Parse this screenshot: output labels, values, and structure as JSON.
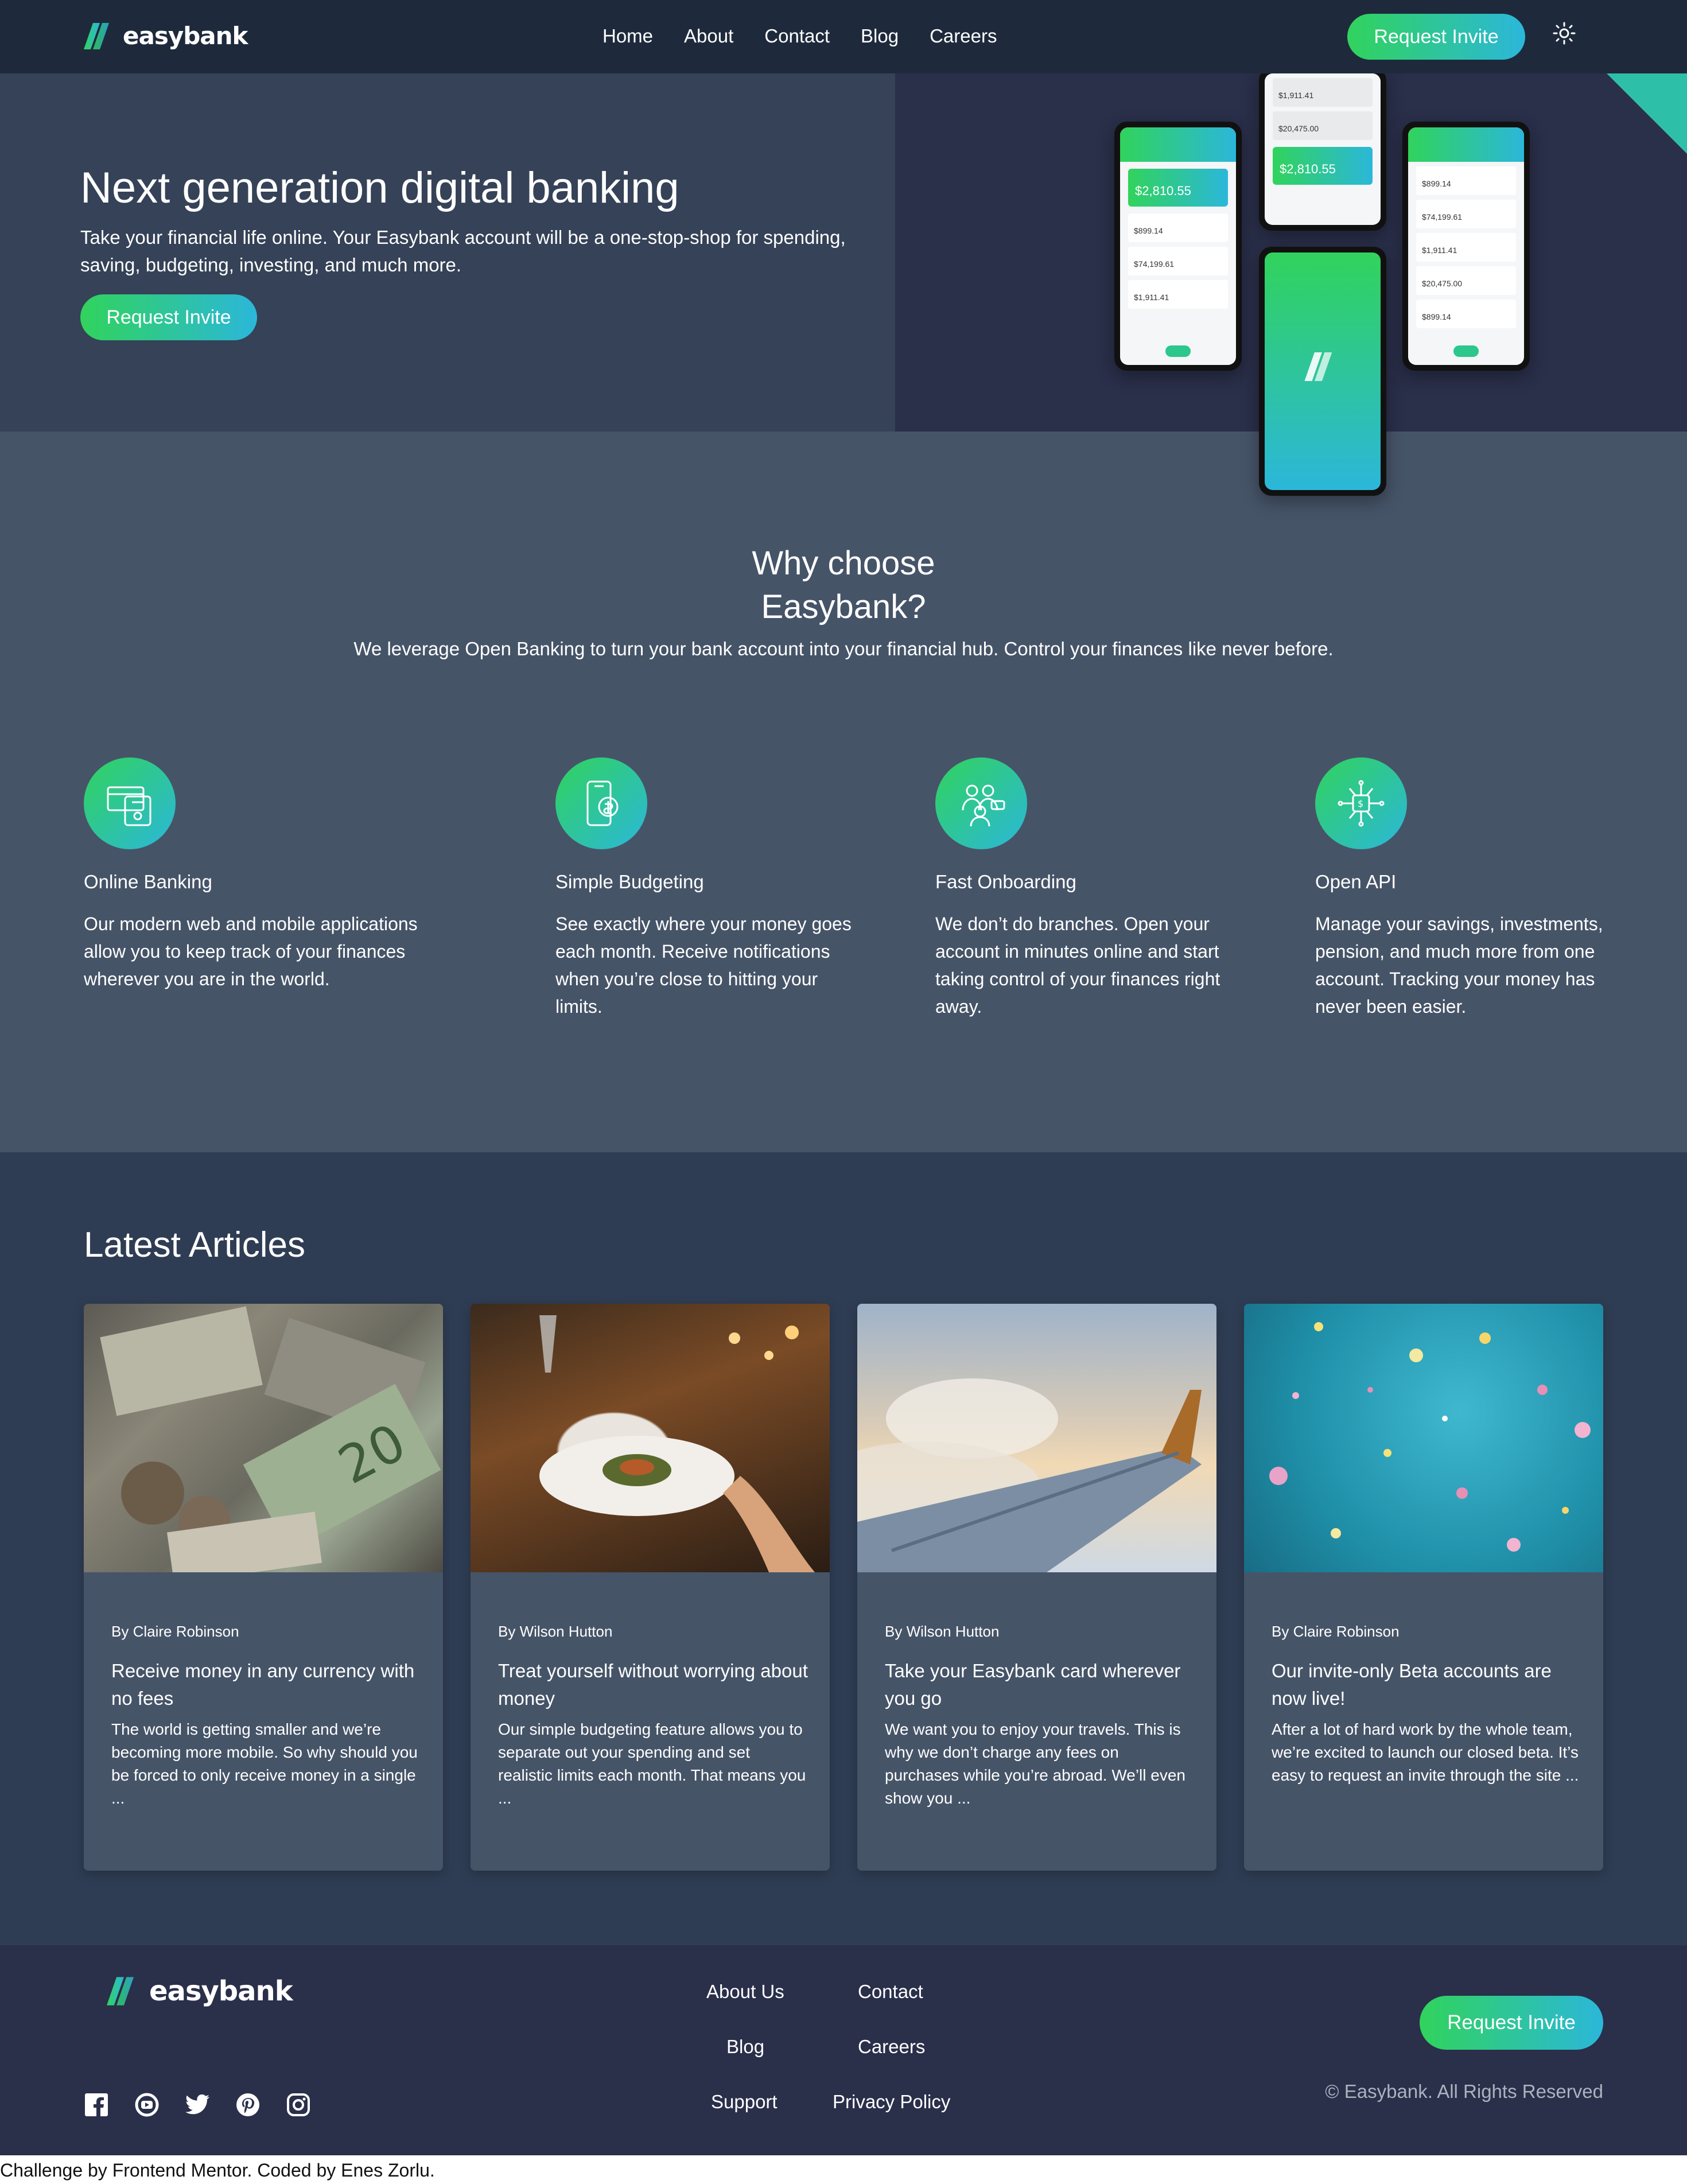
{
  "brand": {
    "name": "easybank"
  },
  "colors": {
    "accent_from": "#31d35c",
    "accent_to": "#2bb7da",
    "header_bg": "#1e2a3c",
    "hero_bg": "#354257",
    "section_bg": "#465468",
    "articles_bg": "#2f3d54",
    "footer_bg": "#2a2f4a"
  },
  "header": {
    "nav": [
      "Home",
      "About",
      "Contact",
      "Blog",
      "Careers"
    ],
    "cta": "Request Invite",
    "theme_icon": "sun-icon"
  },
  "hero": {
    "title": "Next generation digital banking",
    "text": "Take your financial life online. Your Easybank account will be a one-stop-shop for spending, saving, budgeting, investing, and much more.",
    "cta": "Request Invite",
    "phones": {
      "balance": "$2,810.55",
      "amounts": [
        "$899.14",
        "$74,199.61",
        "$1,911.41",
        "$20,475.00"
      ]
    }
  },
  "why": {
    "title_line1": "Why choose",
    "title_line2": "Easybank?",
    "subtitle": "We leverage Open Banking to turn your bank account into your financial hub. Control your finances like never before.",
    "features": [
      {
        "icon": "online-banking-icon",
        "title": "Online Banking",
        "text": "Our modern web and mobile applications allow you to keep track of your finances wherever you are in the world."
      },
      {
        "icon": "budgeting-icon",
        "title": "Simple Budgeting",
        "text": "See exactly where your money goes each month. Receive notifications when you’re close to hitting your limits."
      },
      {
        "icon": "onboarding-icon",
        "title": "Fast Onboarding",
        "text": "We don’t do branches. Open your account in minutes online and start taking control of your finances right away."
      },
      {
        "icon": "api-icon",
        "title": "Open API",
        "text": "Manage your savings, investments, pension, and much more from one account. Tracking your money has never been easier."
      }
    ]
  },
  "articles": {
    "title": "Latest Articles",
    "items": [
      {
        "image": "currency-photo",
        "author": "By Claire Robinson",
        "title": "Receive money in any currency with no fees",
        "text": "The world is getting smaller and we’re becoming more mobile. So why should you be forced to only receive money in a single ..."
      },
      {
        "image": "restaurant-photo",
        "author": "By Wilson Hutton",
        "title": "Treat yourself without worrying about money",
        "text": "Our simple budgeting feature allows you to separate out your spending and set realistic limits each month. That means you ..."
      },
      {
        "image": "plane-photo",
        "author": "By Wilson Hutton",
        "title": "Take your Easybank card wherever you go",
        "text": "We want you to enjoy your travels. This is why we don’t charge any fees on purchases while you’re abroad. We’ll even show you ..."
      },
      {
        "image": "confetti-photo",
        "author": "By Claire Robinson",
        "title": "Our invite-only Beta accounts are now live!",
        "text": "After a lot of hard work by the whole team, we’re excited to launch our closed beta. It’s easy to request an invite through the site ..."
      }
    ]
  },
  "footer": {
    "links": [
      "About Us",
      "Contact",
      "Blog",
      "Careers",
      "Support",
      "Privacy Policy"
    ],
    "socials": [
      "facebook-icon",
      "youtube-icon",
      "twitter-icon",
      "pinterest-icon",
      "instagram-icon"
    ],
    "cta": "Request Invite",
    "copyright": "© Easybank. All Rights Reserved"
  },
  "credit": "Challenge by Frontend Mentor. Coded by Enes Zorlu."
}
